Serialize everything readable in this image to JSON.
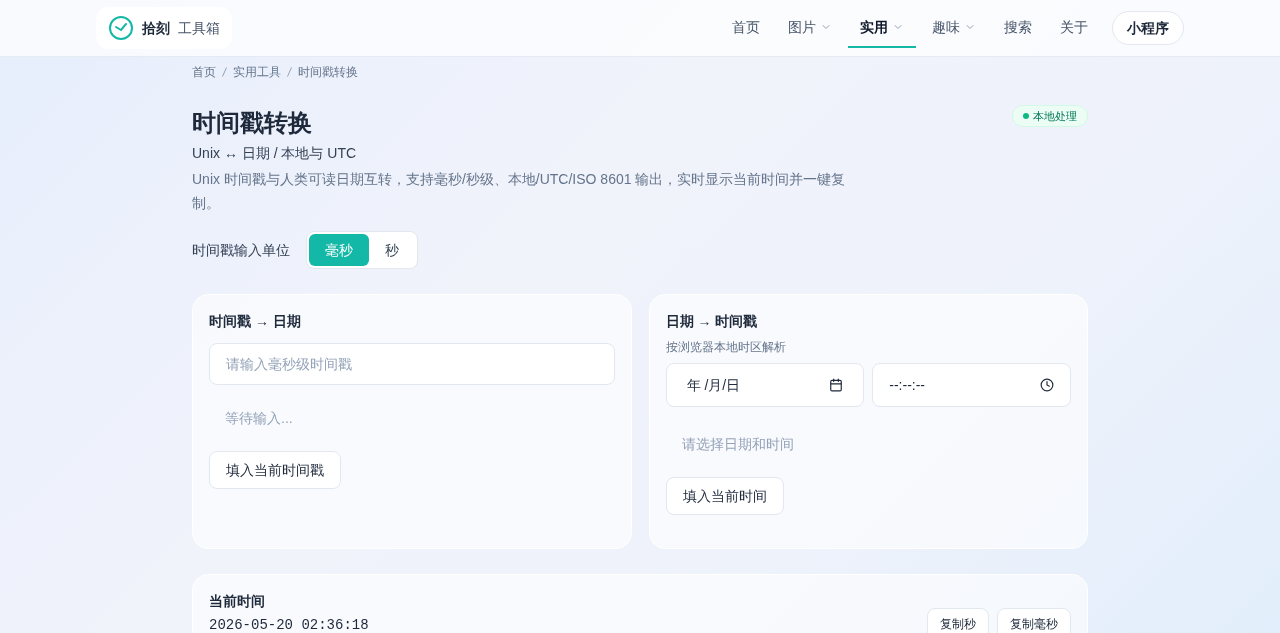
{
  "brand": {
    "name": "拾刻",
    "sub": "工具箱"
  },
  "nav": [
    {
      "label": "首页",
      "dropdown": false,
      "selected": false
    },
    {
      "label": "图片",
      "dropdown": true,
      "selected": false
    },
    {
      "label": "实用",
      "dropdown": true,
      "selected": true
    },
    {
      "label": "趣味",
      "dropdown": true,
      "selected": false
    },
    {
      "label": "搜索",
      "dropdown": false,
      "selected": false
    },
    {
      "label": "关于",
      "dropdown": false,
      "selected": false
    }
  ],
  "nav_button": "小程序",
  "breadcrumb": [
    "首页",
    "实用工具",
    "时间戳转换"
  ],
  "title": "时间戳转换",
  "badge": "本地处理",
  "subtitle": "Unix ↔ 日期 / 本地与 UTC",
  "description": "Unix 时间戳与人类可读日期互转，支持毫秒/秒级、本地/UTC/ISO 8601 输出，实时显示当前时间并一键复制。",
  "unit": {
    "label": "时间戳输入单位",
    "options": [
      {
        "label": "毫秒",
        "selected": true
      },
      {
        "label": "秒",
        "selected": false
      }
    ]
  },
  "ts_to_date": {
    "title": "时间戳 → 日期",
    "placeholder": "请输入毫秒级时间戳",
    "result": "等待输入...",
    "button": "填入当前时间戳"
  },
  "date_to_ts": {
    "title": "日期 → 时间戳",
    "hint": "按浏览器本地时区解析",
    "date_value": "年 /月/日",
    "time_value": "--:--:--",
    "result": "请选择日期和时间",
    "button": "填入当前时间"
  },
  "now": {
    "title": "当前时间",
    "value": "2026-05-20 02:36:18",
    "buttons": [
      "复制秒",
      "复制毫秒"
    ]
  }
}
